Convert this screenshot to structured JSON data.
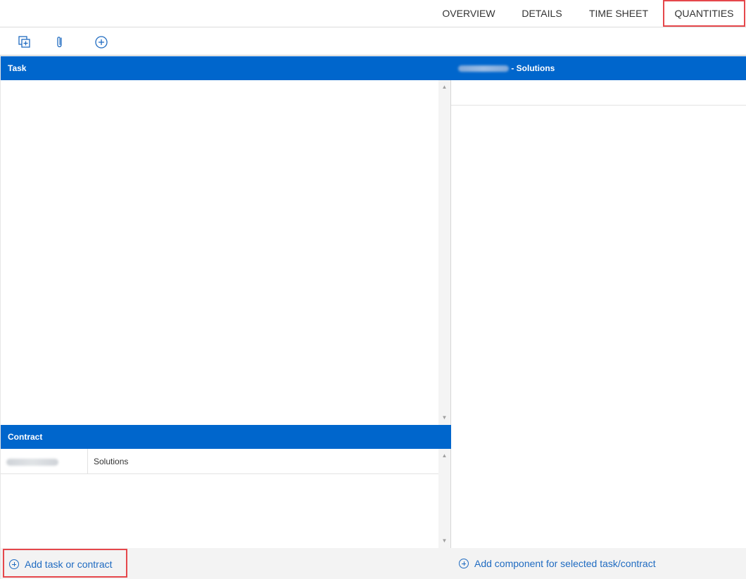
{
  "tabs": [
    {
      "label": "OVERVIEW"
    },
    {
      "label": "DETAILS"
    },
    {
      "label": "TIME SHEET"
    },
    {
      "label": "QUANTITIES",
      "active": true
    }
  ],
  "toolbar": {
    "icons": [
      "copy-add-icon",
      "paperclip-icon",
      "add-circle-icon"
    ]
  },
  "task_panel": {
    "header": "Task"
  },
  "contract_panel": {
    "header": "Contract",
    "rows": [
      {
        "name": "Solutions"
      }
    ]
  },
  "components_panel": {
    "header_suffix": "- Solutions"
  },
  "footer": {
    "add_task_label": "Add task or contract",
    "add_component_label": "Add component for selected task/contract"
  },
  "colors": {
    "header_blue": "#0066cc",
    "link_blue": "#1f6bc1",
    "highlight_red": "#e5474b"
  }
}
